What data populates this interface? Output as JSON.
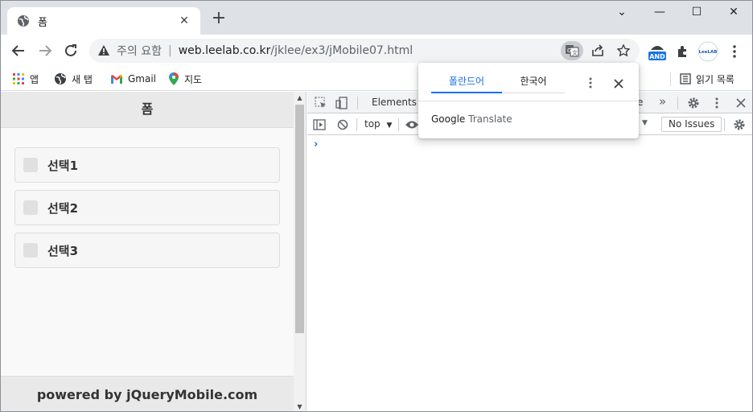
{
  "browser": {
    "tab": {
      "title": "폼",
      "close_glyph": "✕"
    },
    "new_tab_glyph": "+",
    "window_controls": {
      "collapse": "⌄",
      "minimize": "—",
      "maximize": "☐",
      "close": "✕"
    },
    "address": {
      "security_label": "주의 요함",
      "separator": "|",
      "host": "web.leelab.co.kr",
      "path": "/jklee/ex3/jMobile07.html"
    },
    "extensions": {
      "and_badge": "AND",
      "leelab_badge": "LeeLAB"
    },
    "bookmarks": [
      {
        "label": "앱",
        "icon": "apps-grid-icon"
      },
      {
        "label": "새 탭",
        "icon": "globe-icon"
      },
      {
        "label": "Gmail",
        "icon": "gmail-icon"
      },
      {
        "label": "지도",
        "icon": "maps-pin-icon"
      }
    ],
    "reading_list_label": "읽기 목록"
  },
  "page": {
    "header_title": "폼",
    "checkboxes": [
      {
        "label": "선택1",
        "checked": false
      },
      {
        "label": "선택2",
        "checked": false
      },
      {
        "label": "선택3",
        "checked": false
      }
    ],
    "footer_text": "powered by jQueryMobile.com"
  },
  "devtools": {
    "tabs": {
      "elements": "Elements",
      "partial_tab_fragment": "e",
      "more": "»"
    },
    "console": {
      "context": "top",
      "context_arrow": "▼",
      "levels_arrow": "▼",
      "issues": "No Issues",
      "prompt": "›"
    }
  },
  "translate_popup": {
    "source_lang": "폴란드어",
    "target_lang": "한국어",
    "brand_google": "Google",
    "brand_translate": "Translate"
  },
  "colors": {
    "accent": "#1a73e8",
    "tabstrip": "#dee1e6",
    "jqm_bar": "#e9e9e9"
  }
}
